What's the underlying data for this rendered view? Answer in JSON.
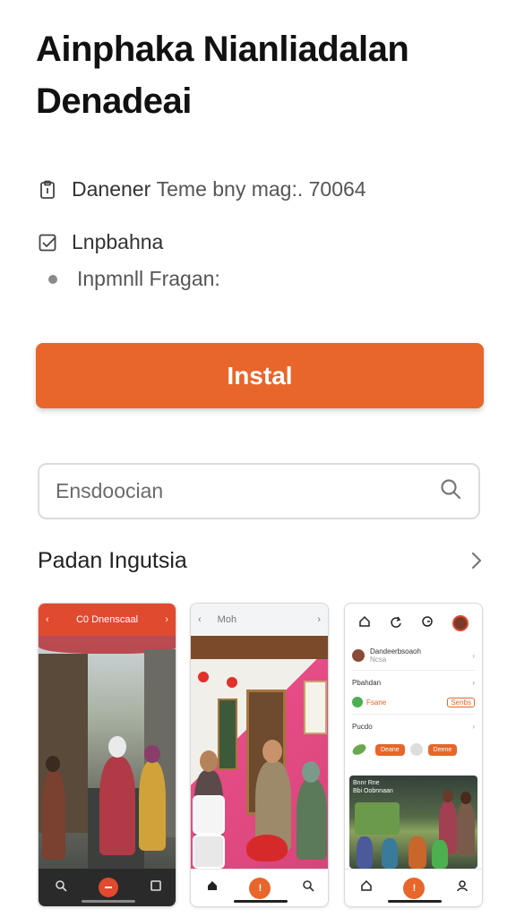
{
  "app": {
    "title_line1": "Ainphaka Nianliadalan",
    "title_line2": "Denadeai"
  },
  "meta": {
    "developer_label": "Danener",
    "developer_info": "Teme bny mag:. 70064",
    "category": "Lnpbahna",
    "info": "Inpmnll Fragan:"
  },
  "install_button": {
    "label": "Instal"
  },
  "search": {
    "placeholder": "Ensdoocian"
  },
  "screenshots_section": {
    "title": "Padan Ingutsia"
  },
  "screens": {
    "s1": {
      "title": "C0 Dnenscaal"
    },
    "s2": {
      "title": "Moh"
    },
    "s3": {
      "row1": "Dandeerbsoaoh",
      "row1_sub": "Ncsa",
      "row2": "Pbahdan",
      "row2_chip": "Fsane",
      "row2_right": "Senbs",
      "row3": "Pucdo",
      "btn_a": "Deane",
      "btn_b": "Deene",
      "photo_caption": "Bnnr Rne\nBbi Oobnnaan"
    }
  },
  "colors": {
    "accent": "#e8662b",
    "red_header": "#e04a2f"
  }
}
